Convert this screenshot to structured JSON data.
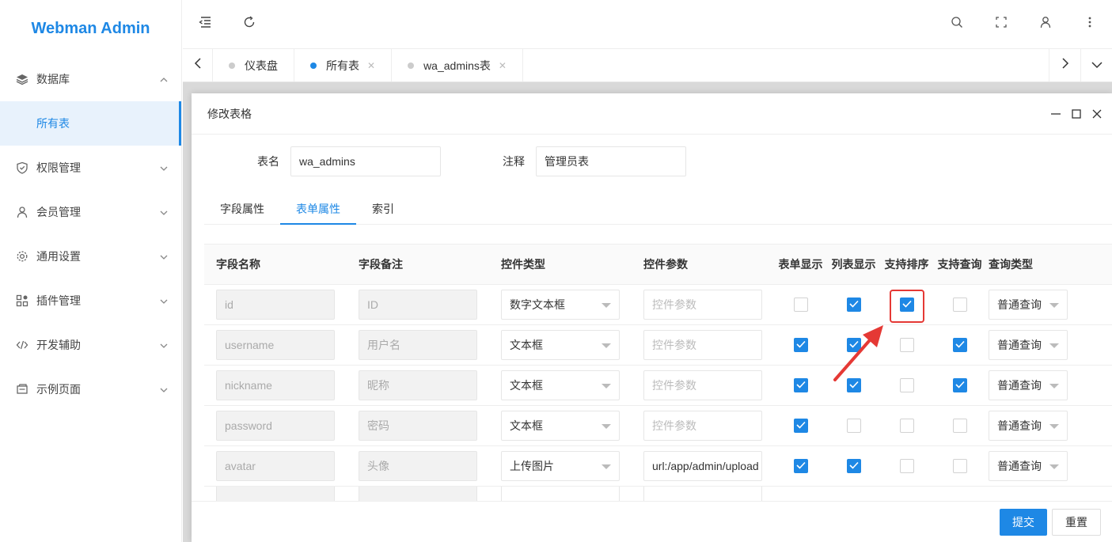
{
  "brand": "Webman Admin",
  "sidebar": {
    "items": [
      {
        "label": "数据库",
        "icon": "layers-icon",
        "expanded": true
      },
      {
        "label": "所有表",
        "sub": true,
        "active": true
      },
      {
        "label": "权限管理",
        "icon": "shield-icon"
      },
      {
        "label": "会员管理",
        "icon": "user-icon"
      },
      {
        "label": "通用设置",
        "icon": "gear-icon"
      },
      {
        "label": "插件管理",
        "icon": "plugin-icon"
      },
      {
        "label": "开发辅助",
        "icon": "code-icon"
      },
      {
        "label": "示例页面",
        "icon": "page-icon"
      }
    ]
  },
  "tabs": [
    {
      "label": "仪表盘",
      "active": false,
      "closable": false
    },
    {
      "label": "所有表",
      "active": true,
      "closable": true
    },
    {
      "label": "wa_admins表",
      "active": false,
      "closable": true
    }
  ],
  "dialog": {
    "title": "修改表格",
    "table_name_label": "表名",
    "table_name_value": "wa_admins",
    "comment_label": "注释",
    "comment_value": "管理员表",
    "subtabs": [
      "字段属性",
      "表单属性",
      "索引"
    ],
    "active_subtab": 1,
    "columns": [
      "字段名称",
      "字段备注",
      "控件类型",
      "控件参数",
      "表单显示",
      "列表显示",
      "支持排序",
      "支持查询",
      "查询类型"
    ],
    "param_placeholder": "控件参数",
    "rows": [
      {
        "name": "id",
        "comment": "ID",
        "control": "数字文本框",
        "param": "",
        "form": false,
        "list": true,
        "sort": true,
        "search": false,
        "query": "普通查询"
      },
      {
        "name": "username",
        "comment": "用户名",
        "control": "文本框",
        "param": "",
        "form": true,
        "list": true,
        "sort": false,
        "search": true,
        "query": "普通查询"
      },
      {
        "name": "nickname",
        "comment": "昵称",
        "control": "文本框",
        "param": "",
        "form": true,
        "list": true,
        "sort": false,
        "search": true,
        "query": "普通查询"
      },
      {
        "name": "password",
        "comment": "密码",
        "control": "文本框",
        "param": "",
        "form": true,
        "list": false,
        "sort": false,
        "search": false,
        "query": "普通查询"
      },
      {
        "name": "avatar",
        "comment": "头像",
        "control": "上传图片",
        "param": "url:/app/admin/upload",
        "form": true,
        "list": true,
        "sort": false,
        "search": false,
        "query": "普通查询"
      }
    ],
    "submit": "提交",
    "reset": "重置"
  },
  "accent": "#1e88e5",
  "highlight_color": "#e53935"
}
